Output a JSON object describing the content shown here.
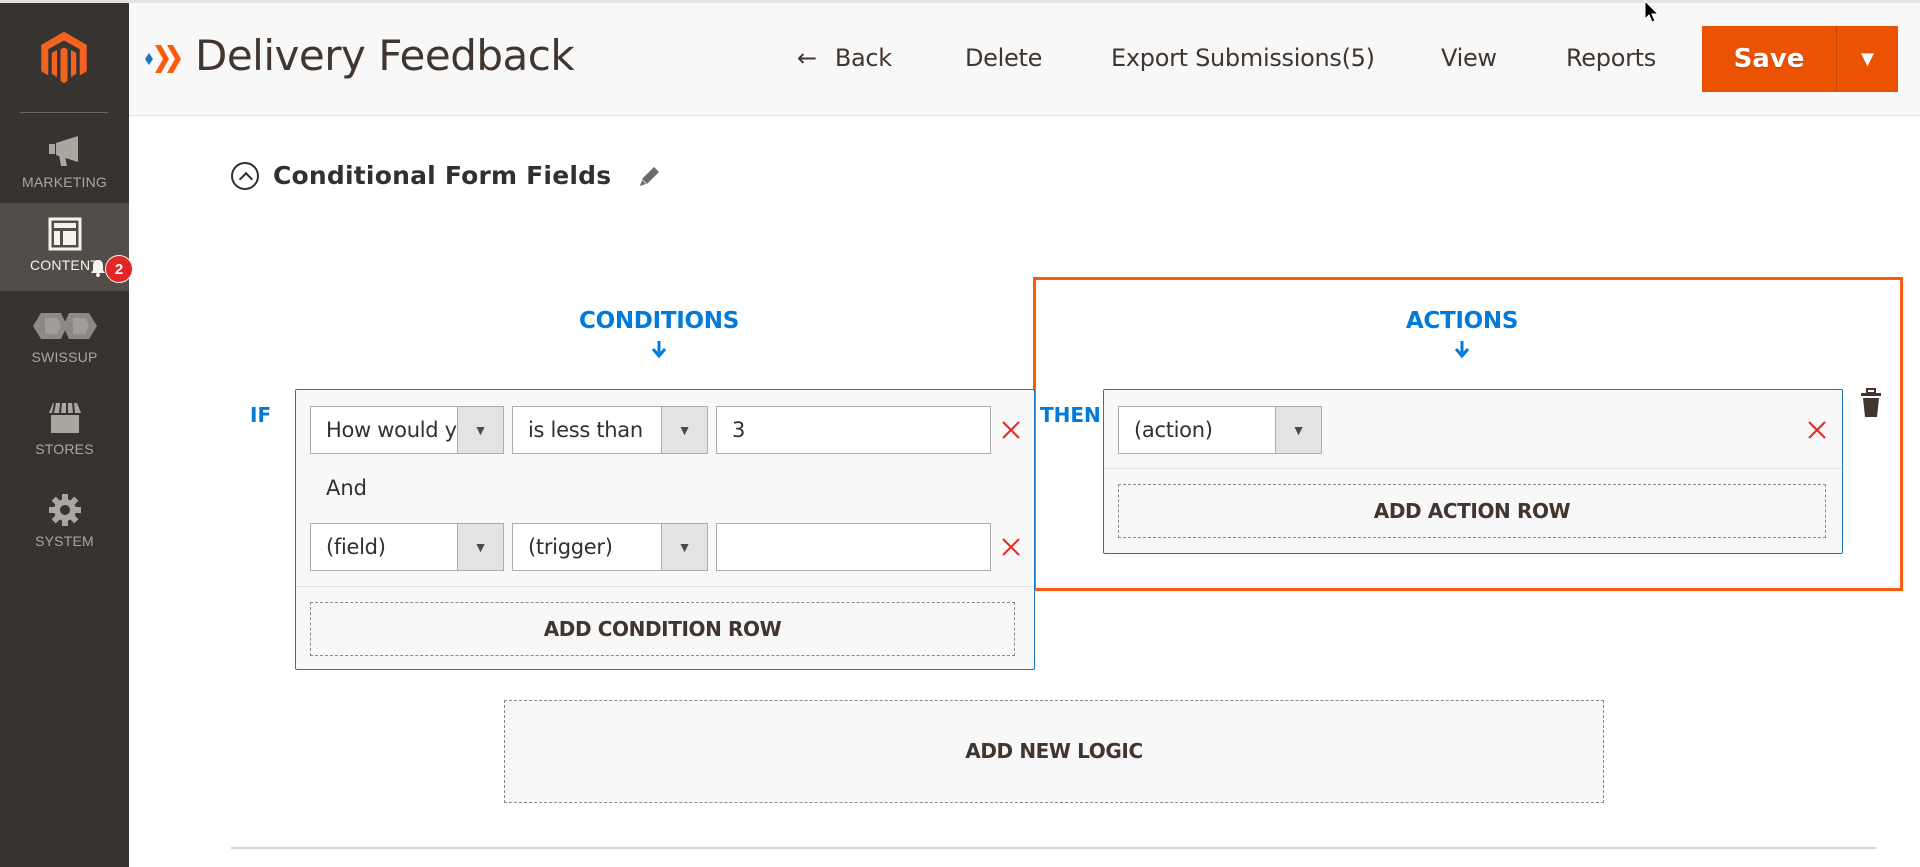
{
  "sidebar": {
    "items": [
      {
        "label": "MARKETING",
        "icon": "megaphone-icon",
        "active": false
      },
      {
        "label": "CONTENT",
        "icon": "layout-icon",
        "active": true,
        "notification_count": "2"
      },
      {
        "label": "SWISSUP",
        "icon": "swissup-icon",
        "active": false
      },
      {
        "label": "STORES",
        "icon": "store-icon",
        "active": false
      },
      {
        "label": "SYSTEM",
        "icon": "gear-icon",
        "active": false
      }
    ]
  },
  "header": {
    "title": "Delivery Feedback",
    "actions": {
      "back": "Back",
      "delete": "Delete",
      "export": "Export Submissions(5)",
      "view": "View",
      "reports": "Reports",
      "save": "Save",
      "save_dropdown_glyph": "▼"
    }
  },
  "section": {
    "title": "Conditional Form Fields"
  },
  "logic": {
    "conditions_heading": "CONDITIONS",
    "actions_heading": "ACTIONS",
    "down_arrow_glyph": "🡓",
    "if_label": "IF",
    "then_label": "THEN",
    "and_label": "And",
    "conditions": [
      {
        "field": "How would you",
        "trigger": "is less than",
        "value": "3"
      },
      {
        "field": "(field)",
        "trigger": "(trigger)",
        "value": ""
      }
    ],
    "actions": [
      {
        "action": "(action)"
      }
    ],
    "add_condition_row": "ADD CONDITION ROW",
    "add_action_row": "ADD ACTION ROW",
    "add_new_logic": "ADD NEW LOGIC",
    "select_arrow_glyph": "▼"
  },
  "colors": {
    "accent_orange": "#eb5202",
    "highlight_orange": "#fb5b0a",
    "link_blue": "#007bdb",
    "box_border_blue": "#1979c3",
    "remove_red": "#e22626",
    "sidebar_bg": "#373330"
  }
}
